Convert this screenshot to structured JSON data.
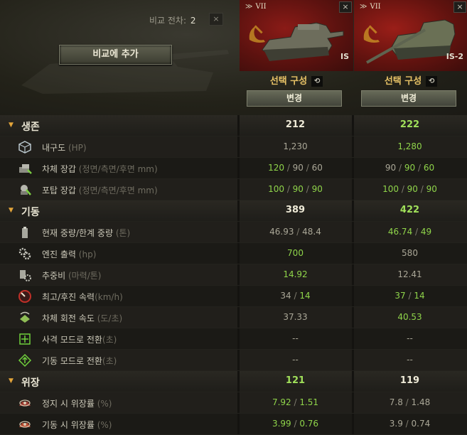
{
  "header": {
    "compare_label": "비교 전차:",
    "compare_count": "2",
    "close_glyph": "×",
    "add_button": "비교에 추가"
  },
  "vehicles": [
    {
      "tier": "VII",
      "name": "IS",
      "config": "선택 구성",
      "undo_glyph": "⟲",
      "change": "변경",
      "close_glyph": "×",
      "flag_color": "#7a1714"
    },
    {
      "tier": "VII",
      "name": "IS-2",
      "config": "선택 구성",
      "undo_glyph": "⟲",
      "change": "변경",
      "close_glyph": "×",
      "flag_color": "#8a1a15"
    }
  ],
  "sections": [
    {
      "title": "생존",
      "v1": "212",
      "v2": "222",
      "v1_green": false,
      "v2_green": true,
      "rows": [
        {
          "icon": "hp-cube-icon",
          "label": "내구도",
          "sub": " (HP)",
          "v1": [
            "1,230"
          ],
          "v2": [
            "1,280"
          ],
          "g1": [
            false
          ],
          "g2": [
            true
          ]
        },
        {
          "icon": "hull-armor-icon",
          "label": "차체 장갑",
          "sub": " (정면/측면/후면 mm)",
          "v1": [
            "120",
            "90",
            "60"
          ],
          "v2": [
            "90",
            "90",
            "60"
          ],
          "g1": [
            true,
            false,
            false
          ],
          "g2": [
            false,
            true,
            true
          ]
        },
        {
          "icon": "turret-armor-icon",
          "label": "포탑 장갑",
          "sub": " (정면/측면/후면 mm)",
          "v1": [
            "100",
            "90",
            "90"
          ],
          "v2": [
            "100",
            "90",
            "90"
          ],
          "g1": [
            true,
            true,
            true
          ],
          "g2": [
            true,
            true,
            true
          ]
        }
      ]
    },
    {
      "title": "기동",
      "v1": "389",
      "v2": "422",
      "v1_green": false,
      "v2_green": true,
      "rows": [
        {
          "icon": "weight-icon",
          "label": "현재 중량/한계 중량",
          "sub": " (톤)",
          "v1": [
            "46.93",
            "48.4"
          ],
          "v2": [
            "46.74",
            "49"
          ],
          "g1": [
            false,
            false
          ],
          "g2": [
            true,
            true
          ]
        },
        {
          "icon": "engine-gears-icon",
          "label": "엔진 출력",
          "sub": " (hp)",
          "v1": [
            "700"
          ],
          "v2": [
            "580"
          ],
          "g1": [
            true
          ],
          "g2": [
            false
          ]
        },
        {
          "icon": "power-ratio-icon",
          "label": "추중비",
          "sub": " (마력/톤)",
          "v1": [
            "14.92"
          ],
          "v2": [
            "12.41"
          ],
          "g1": [
            true
          ],
          "g2": [
            false
          ]
        },
        {
          "icon": "speedometer-icon",
          "label": "최고/후진 속력",
          "sub": "(km/h)",
          "v1": [
            "34",
            "14"
          ],
          "v2": [
            "37",
            "14"
          ],
          "g1": [
            false,
            true
          ],
          "g2": [
            true,
            true
          ]
        },
        {
          "icon": "hull-traverse-icon",
          "label": "차체 회전 속도",
          "sub": " (도/초)",
          "v1": [
            "37.33"
          ],
          "v2": [
            "40.53"
          ],
          "g1": [
            false
          ],
          "g2": [
            true
          ]
        },
        {
          "icon": "siege-mode-icon",
          "label": "사격 모드로 전환",
          "sub": "(초)",
          "v1": [
            "--"
          ],
          "v2": [
            "--"
          ],
          "g1": [
            false
          ],
          "g2": [
            false
          ]
        },
        {
          "icon": "travel-mode-icon",
          "label": "기동 모드로 전환",
          "sub": "(초)",
          "v1": [
            "--"
          ],
          "v2": [
            "--"
          ],
          "g1": [
            false
          ],
          "g2": [
            false
          ]
        }
      ]
    },
    {
      "title": "위장",
      "v1": "121",
      "v2": "119",
      "v1_green": true,
      "v2_green": false,
      "rows": [
        {
          "icon": "camo-stationary-icon",
          "label": "정지 시 위장률",
          "sub": " (%)",
          "v1": [
            "7.92",
            "1.51"
          ],
          "v2": [
            "7.8",
            "1.48"
          ],
          "g1": [
            true,
            true
          ],
          "g2": [
            false,
            false
          ]
        },
        {
          "icon": "camo-moving-icon",
          "label": "기동 시 위장률",
          "sub": " (%)",
          "v1": [
            "3.99",
            "0.76"
          ],
          "v2": [
            "3.9",
            "0.74"
          ],
          "g1": [
            true,
            true
          ],
          "g2": [
            false,
            false
          ]
        }
      ]
    }
  ],
  "colors": {
    "accent": "#e3a53a",
    "better": "#8fd44a",
    "config": "#e7c266"
  }
}
